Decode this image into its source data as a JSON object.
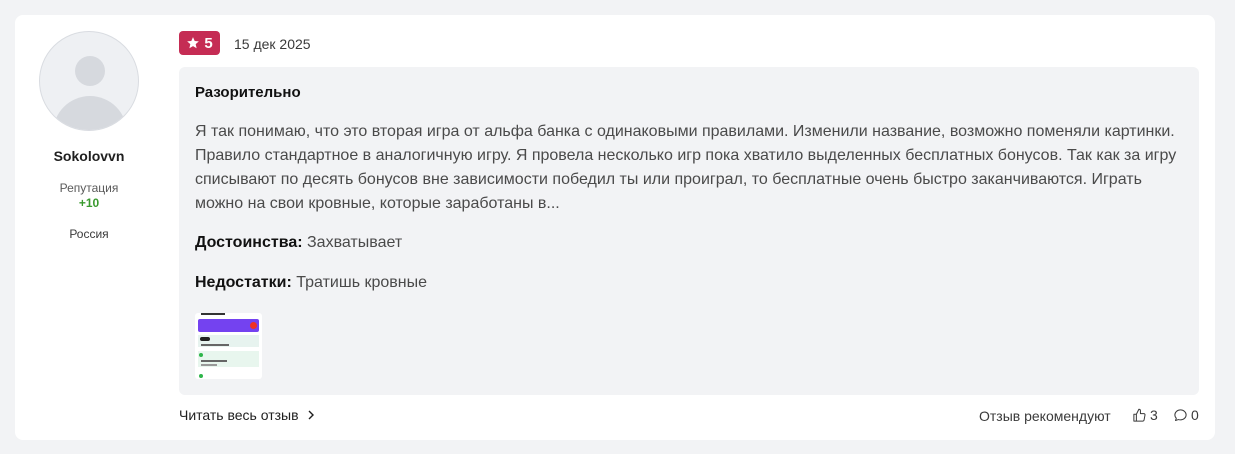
{
  "author": {
    "username": "Sokolovvn",
    "reputation_label": "Репутация",
    "reputation_value": "+10",
    "country": "Россия"
  },
  "review": {
    "rating": "5",
    "date": "15 дек 2025",
    "title": "Разорительно",
    "text": "Я так понимаю, что это вторая игра от альфа банка с одинаковыми правилами. Изменили название, возможно поменяли картинки. Правило стандартное в аналогичную игру. Я провела несколько игр пока хватило выделенных бесплатных бонусов. Так как за игру списывают по десять бонусов вне зависимости победил ты или проиграл, то бесплатные очень быстро заканчиваются. Играть можно на свои кровные, которые заработаны в...",
    "pros_label": "Достоинства:",
    "pros": "Захватывает",
    "cons_label": "Недостатки:",
    "cons": "Тратишь кровные"
  },
  "footer": {
    "read_more": "Читать весь отзыв",
    "recommend": "Отзыв рекомендуют",
    "likes": "3",
    "comments": "0"
  },
  "colors": {
    "rating_badge": "#c52c54",
    "reputation": "#3a9a2f",
    "review_bg": "#f2f3f5"
  },
  "icons": [
    "user-avatar",
    "star-icon",
    "chevron-right-icon",
    "thumbs-up-icon",
    "comment-icon"
  ]
}
